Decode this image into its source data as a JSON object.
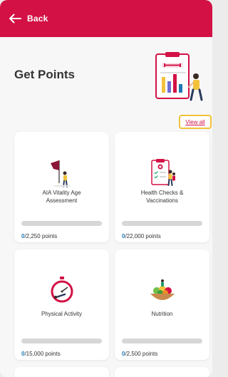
{
  "header": {
    "back_label": "Back",
    "color": "#d31145"
  },
  "page": {
    "title": "Get Points"
  },
  "view_all_label": "View all",
  "cards": [
    {
      "title_line1": "AIA Vitality Age",
      "title_line2": "Assessment",
      "current": "0",
      "total": "/2,250 points",
      "progress": 0,
      "icon": "flag-icon"
    },
    {
      "title_line1": "Health Checks &",
      "title_line2": "Vaccinations",
      "current": "0",
      "total": "/22,000 points",
      "progress": 0,
      "icon": "clipboard-checklist-icon"
    },
    {
      "title_line1": "Physical Activity",
      "title_line2": "",
      "current": "0",
      "total": "/15,000 points",
      "progress": 0,
      "icon": "stopwatch-icon"
    },
    {
      "title_line1": "Nutrition",
      "title_line2": "",
      "current": "0",
      "total": "/2,500 points",
      "progress": 0,
      "icon": "salad-bowl-icon"
    }
  ],
  "colors": {
    "accent": "#d31145",
    "points_current": "#1f78b4",
    "highlight_border": "#f2c23b",
    "bar_track": "#d7d7d7"
  }
}
